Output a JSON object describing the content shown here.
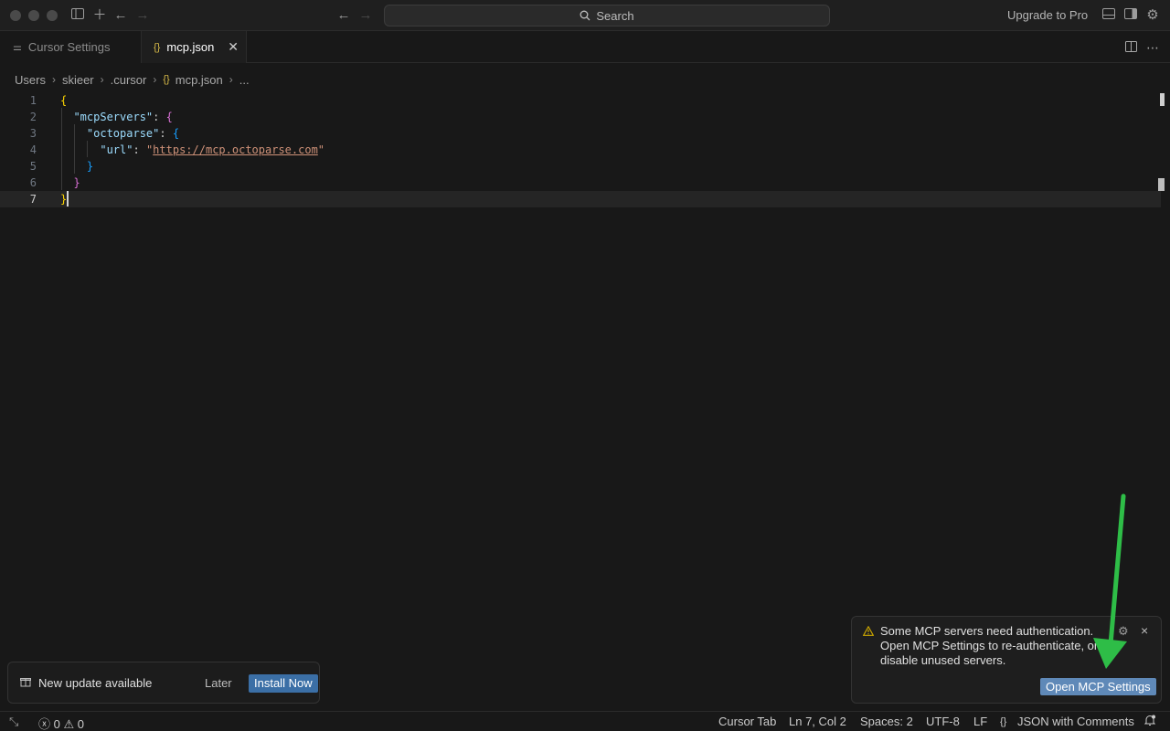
{
  "titlebar": {
    "search_label": "Search",
    "upgrade_label": "Upgrade to Pro"
  },
  "tabs": [
    {
      "label": "Cursor Settings",
      "active": false
    },
    {
      "label": "mcp.json",
      "active": true,
      "icon": "{}"
    }
  ],
  "breadcrumb": {
    "items": [
      "Users",
      "skieer",
      ".cursor",
      "mcp.json",
      "..."
    ],
    "file_icon": "{}"
  },
  "editor": {
    "lines": [
      {
        "number": "1"
      },
      {
        "number": "2",
        "key": "\"mcpServers\"",
        "punct": ": "
      },
      {
        "number": "3",
        "key": "\"octoparse\"",
        "punct": ": "
      },
      {
        "number": "4",
        "key": "\"url\"",
        "punct": ": ",
        "quote_open": "\"",
        "value": "https://mcp.octoparse.com",
        "quote_close": "\""
      },
      {
        "number": "5"
      },
      {
        "number": "6"
      },
      {
        "number": "7"
      }
    ],
    "brackets": {
      "open": "{",
      "close": "}"
    }
  },
  "update_toast": {
    "message": "New update available",
    "later_label": "Later",
    "install_label": "Install Now"
  },
  "notification": {
    "lines": [
      "Some MCP servers need authentication.",
      "Open MCP Settings to re-authenticate, or",
      "disable unused servers."
    ],
    "button_label": "Open MCP Settings"
  },
  "statusbar": {
    "errors": "0",
    "warnings": "0",
    "cursor_tab": "Cursor Tab",
    "position": "Ln 7, Col 2",
    "spaces": "Spaces: 2",
    "encoding": "UTF-8",
    "eol": "LF",
    "language_icon": "{}",
    "language": "JSON with Comments"
  },
  "colors": {
    "background": "#181818",
    "accent_button": "#3b6fa6",
    "annotation_arrow": "#2ebd47",
    "warning": "#cca700"
  }
}
